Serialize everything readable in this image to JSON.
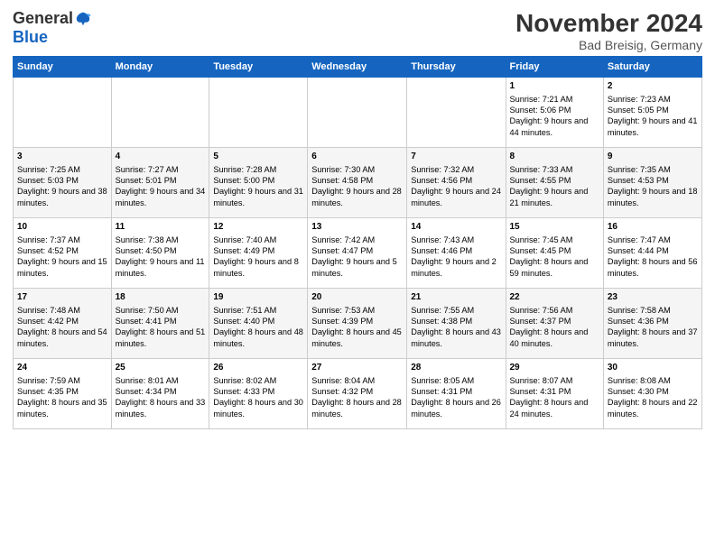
{
  "logo": {
    "general": "General",
    "blue": "Blue"
  },
  "header": {
    "title": "November 2024",
    "subtitle": "Bad Breisig, Germany"
  },
  "columns": [
    "Sunday",
    "Monday",
    "Tuesday",
    "Wednesday",
    "Thursday",
    "Friday",
    "Saturday"
  ],
  "weeks": [
    [
      {
        "day": "",
        "info": ""
      },
      {
        "day": "",
        "info": ""
      },
      {
        "day": "",
        "info": ""
      },
      {
        "day": "",
        "info": ""
      },
      {
        "day": "",
        "info": ""
      },
      {
        "day": "1",
        "info": "Sunrise: 7:21 AM\nSunset: 5:06 PM\nDaylight: 9 hours and 44 minutes."
      },
      {
        "day": "2",
        "info": "Sunrise: 7:23 AM\nSunset: 5:05 PM\nDaylight: 9 hours and 41 minutes."
      }
    ],
    [
      {
        "day": "3",
        "info": "Sunrise: 7:25 AM\nSunset: 5:03 PM\nDaylight: 9 hours and 38 minutes."
      },
      {
        "day": "4",
        "info": "Sunrise: 7:27 AM\nSunset: 5:01 PM\nDaylight: 9 hours and 34 minutes."
      },
      {
        "day": "5",
        "info": "Sunrise: 7:28 AM\nSunset: 5:00 PM\nDaylight: 9 hours and 31 minutes."
      },
      {
        "day": "6",
        "info": "Sunrise: 7:30 AM\nSunset: 4:58 PM\nDaylight: 9 hours and 28 minutes."
      },
      {
        "day": "7",
        "info": "Sunrise: 7:32 AM\nSunset: 4:56 PM\nDaylight: 9 hours and 24 minutes."
      },
      {
        "day": "8",
        "info": "Sunrise: 7:33 AM\nSunset: 4:55 PM\nDaylight: 9 hours and 21 minutes."
      },
      {
        "day": "9",
        "info": "Sunrise: 7:35 AM\nSunset: 4:53 PM\nDaylight: 9 hours and 18 minutes."
      }
    ],
    [
      {
        "day": "10",
        "info": "Sunrise: 7:37 AM\nSunset: 4:52 PM\nDaylight: 9 hours and 15 minutes."
      },
      {
        "day": "11",
        "info": "Sunrise: 7:38 AM\nSunset: 4:50 PM\nDaylight: 9 hours and 11 minutes."
      },
      {
        "day": "12",
        "info": "Sunrise: 7:40 AM\nSunset: 4:49 PM\nDaylight: 9 hours and 8 minutes."
      },
      {
        "day": "13",
        "info": "Sunrise: 7:42 AM\nSunset: 4:47 PM\nDaylight: 9 hours and 5 minutes."
      },
      {
        "day": "14",
        "info": "Sunrise: 7:43 AM\nSunset: 4:46 PM\nDaylight: 9 hours and 2 minutes."
      },
      {
        "day": "15",
        "info": "Sunrise: 7:45 AM\nSunset: 4:45 PM\nDaylight: 8 hours and 59 minutes."
      },
      {
        "day": "16",
        "info": "Sunrise: 7:47 AM\nSunset: 4:44 PM\nDaylight: 8 hours and 56 minutes."
      }
    ],
    [
      {
        "day": "17",
        "info": "Sunrise: 7:48 AM\nSunset: 4:42 PM\nDaylight: 8 hours and 54 minutes."
      },
      {
        "day": "18",
        "info": "Sunrise: 7:50 AM\nSunset: 4:41 PM\nDaylight: 8 hours and 51 minutes."
      },
      {
        "day": "19",
        "info": "Sunrise: 7:51 AM\nSunset: 4:40 PM\nDaylight: 8 hours and 48 minutes."
      },
      {
        "day": "20",
        "info": "Sunrise: 7:53 AM\nSunset: 4:39 PM\nDaylight: 8 hours and 45 minutes."
      },
      {
        "day": "21",
        "info": "Sunrise: 7:55 AM\nSunset: 4:38 PM\nDaylight: 8 hours and 43 minutes."
      },
      {
        "day": "22",
        "info": "Sunrise: 7:56 AM\nSunset: 4:37 PM\nDaylight: 8 hours and 40 minutes."
      },
      {
        "day": "23",
        "info": "Sunrise: 7:58 AM\nSunset: 4:36 PM\nDaylight: 8 hours and 37 minutes."
      }
    ],
    [
      {
        "day": "24",
        "info": "Sunrise: 7:59 AM\nSunset: 4:35 PM\nDaylight: 8 hours and 35 minutes."
      },
      {
        "day": "25",
        "info": "Sunrise: 8:01 AM\nSunset: 4:34 PM\nDaylight: 8 hours and 33 minutes."
      },
      {
        "day": "26",
        "info": "Sunrise: 8:02 AM\nSunset: 4:33 PM\nDaylight: 8 hours and 30 minutes."
      },
      {
        "day": "27",
        "info": "Sunrise: 8:04 AM\nSunset: 4:32 PM\nDaylight: 8 hours and 28 minutes."
      },
      {
        "day": "28",
        "info": "Sunrise: 8:05 AM\nSunset: 4:31 PM\nDaylight: 8 hours and 26 minutes."
      },
      {
        "day": "29",
        "info": "Sunrise: 8:07 AM\nSunset: 4:31 PM\nDaylight: 8 hours and 24 minutes."
      },
      {
        "day": "30",
        "info": "Sunrise: 8:08 AM\nSunset: 4:30 PM\nDaylight: 8 hours and 22 minutes."
      }
    ]
  ]
}
